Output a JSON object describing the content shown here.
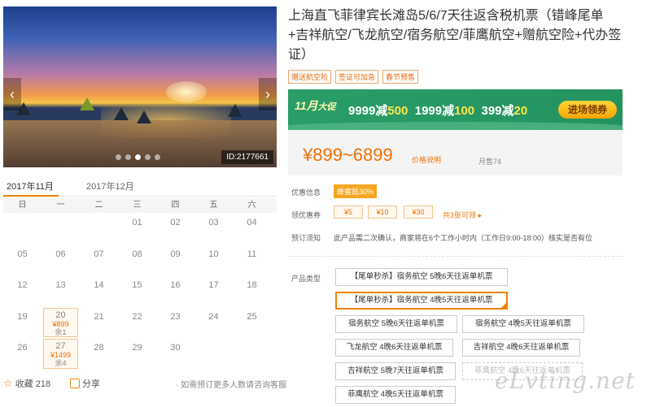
{
  "gallery": {
    "photo_id": "ID:2177661",
    "prev_label": "‹",
    "next_label": "›",
    "slide_count": 5,
    "active_slide": 2
  },
  "calendar": {
    "tabs": [
      "2017年11月",
      "2017年12月"
    ],
    "weekdays": [
      "日",
      "一",
      "二",
      "三",
      "四",
      "五",
      "六"
    ],
    "rows": [
      [
        {
          "d": ""
        },
        {
          "d": ""
        },
        {
          "d": ""
        },
        {
          "d": "01"
        },
        {
          "d": "02"
        },
        {
          "d": "03"
        },
        {
          "d": "04"
        }
      ],
      [
        {
          "d": "05"
        },
        {
          "d": "06"
        },
        {
          "d": "07"
        },
        {
          "d": "08"
        },
        {
          "d": "09"
        },
        {
          "d": "10"
        },
        {
          "d": "11"
        }
      ],
      [
        {
          "d": "12"
        },
        {
          "d": "13"
        },
        {
          "d": "14"
        },
        {
          "d": "15"
        },
        {
          "d": "16"
        },
        {
          "d": "17"
        },
        {
          "d": "18"
        }
      ],
      [
        {
          "d": "19"
        },
        {
          "d": "20",
          "price": "¥899",
          "left": "余1"
        },
        {
          "d": "21"
        },
        {
          "d": "22"
        },
        {
          "d": "23"
        },
        {
          "d": "24"
        },
        {
          "d": "25"
        }
      ],
      [
        {
          "d": "26"
        },
        {
          "d": "27",
          "price": "¥1499",
          "left": "余4"
        },
        {
          "d": "28"
        },
        {
          "d": "29"
        },
        {
          "d": "30"
        },
        {
          "d": ""
        },
        {
          "d": ""
        }
      ]
    ]
  },
  "actions": {
    "favorite_label": "收藏",
    "favorite_count": "218",
    "share_label": "分享",
    "hint": "· 如需预订更多人数请咨询客服"
  },
  "product": {
    "title": "上海直飞菲律宾长滩岛5/6/7天往返含税机票（错峰尾单+吉祥航空/飞龙航空/宿务航空/菲鹰航空+赠航空险+代办签证）",
    "tags": [
      "赠送航空险",
      "签证可加急",
      "春节预售"
    ]
  },
  "promo": {
    "badge_main": "11月",
    "badge_sub": "大促",
    "offers": [
      {
        "prefix": "9999减",
        "amount": "500"
      },
      {
        "prefix": "1999减",
        "amount": "100"
      },
      {
        "prefix": "399减",
        "amount": "20"
      }
    ],
    "button": "进场领券"
  },
  "price": {
    "range": "¥899~6899",
    "note": "价格说明",
    "sold": "月售74"
  },
  "info": {
    "discount_label": "优惠信息",
    "discount_badge": "蜂蜜抵30%",
    "coupon_label": "领优惠券",
    "coupons": [
      "¥5",
      "¥10",
      "¥30"
    ],
    "coupon_more": "共3张可领 ▸",
    "reserve_label": "预订须知",
    "reserve_text": "此产品需二次确认，商家将在6个工作小时内（工作日9:00-18:00）核实是否有位"
  },
  "product_type": {
    "label": "产品类型",
    "options": [
      {
        "text": "【尾单秒杀】宿务航空 5晚6天往返单机票",
        "state": "normal"
      },
      {
        "text": "【尾单秒杀】宿务航空 4晚5天往返单机票",
        "state": "selected"
      },
      {
        "text": "宿务航空 5晚6天往返单机票",
        "state": "normal"
      },
      {
        "text": "宿务航空 4晚5天往返单机票",
        "state": "normal"
      },
      {
        "text": "飞龙航空 4晚6天往返单机票",
        "state": "normal"
      },
      {
        "text": "吉祥航空 4晚6天往返单机票",
        "state": "normal"
      },
      {
        "text": "吉祥航空 5晚7天往返单机票",
        "state": "normal"
      },
      {
        "text": "菲鹰航空 4晚6天往返单机票",
        "state": "disabled"
      },
      {
        "text": "菲鹰航空 4晚5天往返单机票",
        "state": "normal"
      }
    ]
  },
  "watermark": "eLvting.net",
  "colors": {
    "accent": "#f08300",
    "promo_green": "#2a9d68",
    "price": "#f07000"
  }
}
